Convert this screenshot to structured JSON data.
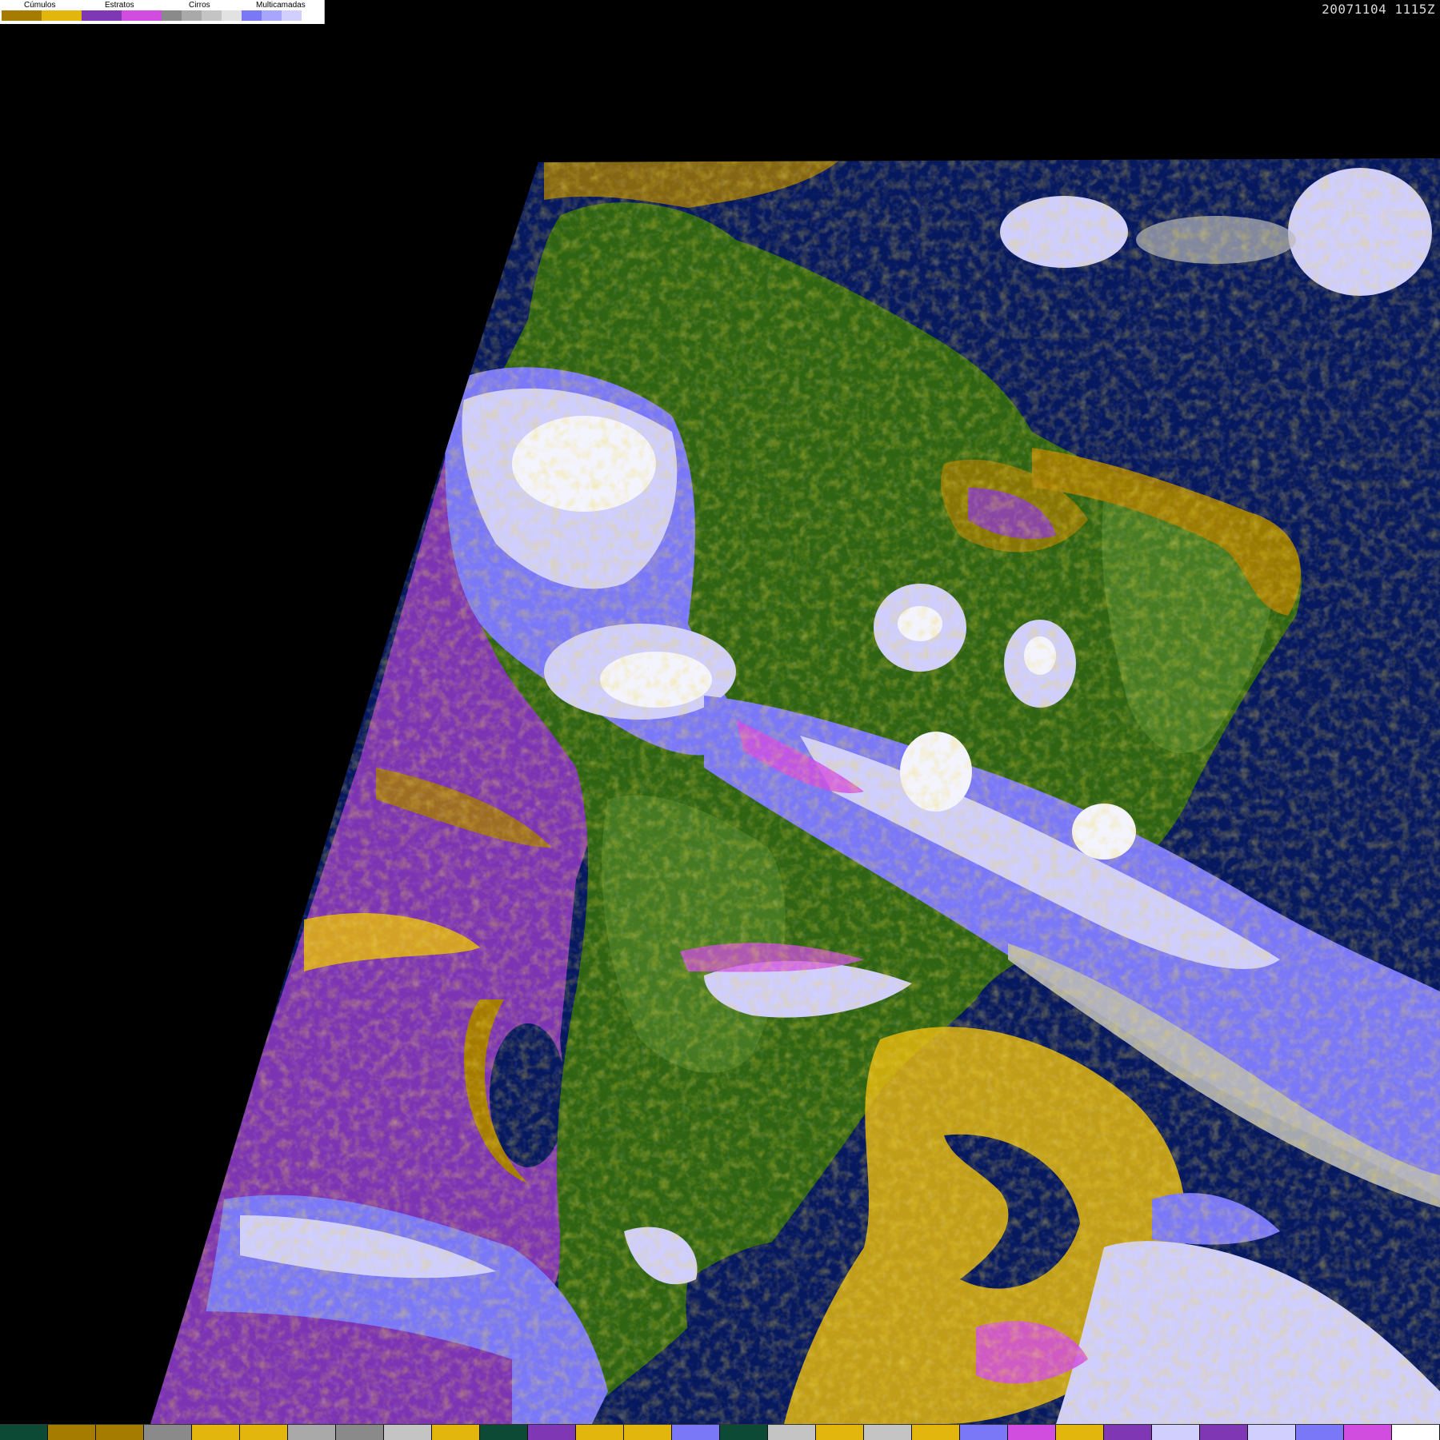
{
  "legend": {
    "categories": [
      {
        "label": "Cúmulos",
        "colors": [
          "#a57c00",
          "#e3b60d"
        ]
      },
      {
        "label": "Estratos",
        "colors": [
          "#7f37b4",
          "#d14de0"
        ]
      },
      {
        "label": "Cirros",
        "colors": [
          "#8a8a8a",
          "#a9a9a9",
          "#c4c4c4",
          "#e2e2e2"
        ]
      },
      {
        "label": "Multicamadas",
        "colors": [
          "#7a78f6",
          "#a8a6fb",
          "#d0cffd",
          "#ffffff"
        ]
      }
    ]
  },
  "timestamp": "20071104 1115Z",
  "bottom_palette": [
    "#0c4a36",
    "#a57c00",
    "#a57c00",
    "#8a8a8a",
    "#e3b60d",
    "#e3b60d",
    "#a9a9a9",
    "#8a8a8a",
    "#c4c4c4",
    "#e3b60d",
    "#0c4a36",
    "#7f37b4",
    "#e3b60d",
    "#e3b60d",
    "#7a78f6",
    "#0c4a36",
    "#c4c4c4",
    "#e3b60d",
    "#c4c4c4",
    "#e3b60d",
    "#7a78f6",
    "#d14de0",
    "#e3b60d",
    "#7f37b4",
    "#d0cffd",
    "#7f37b4",
    "#d0cffd",
    "#7a78f6",
    "#d14de0",
    "#ffffff"
  ],
  "map_colors": {
    "space": "#000000",
    "ocean": "#06185e",
    "land": "#2f6412",
    "land_light": "#4b7e27",
    "stratus_ocean": "#7d34b3",
    "cumulus_dark": "#a57c00",
    "cumulus_light": "#e3b60d",
    "cirrus": "#b8b8b8",
    "multilayer_blue": "#7a78f6",
    "multilayer_light": "#cfcefd",
    "multilayer_white": "#f4f4ff"
  }
}
